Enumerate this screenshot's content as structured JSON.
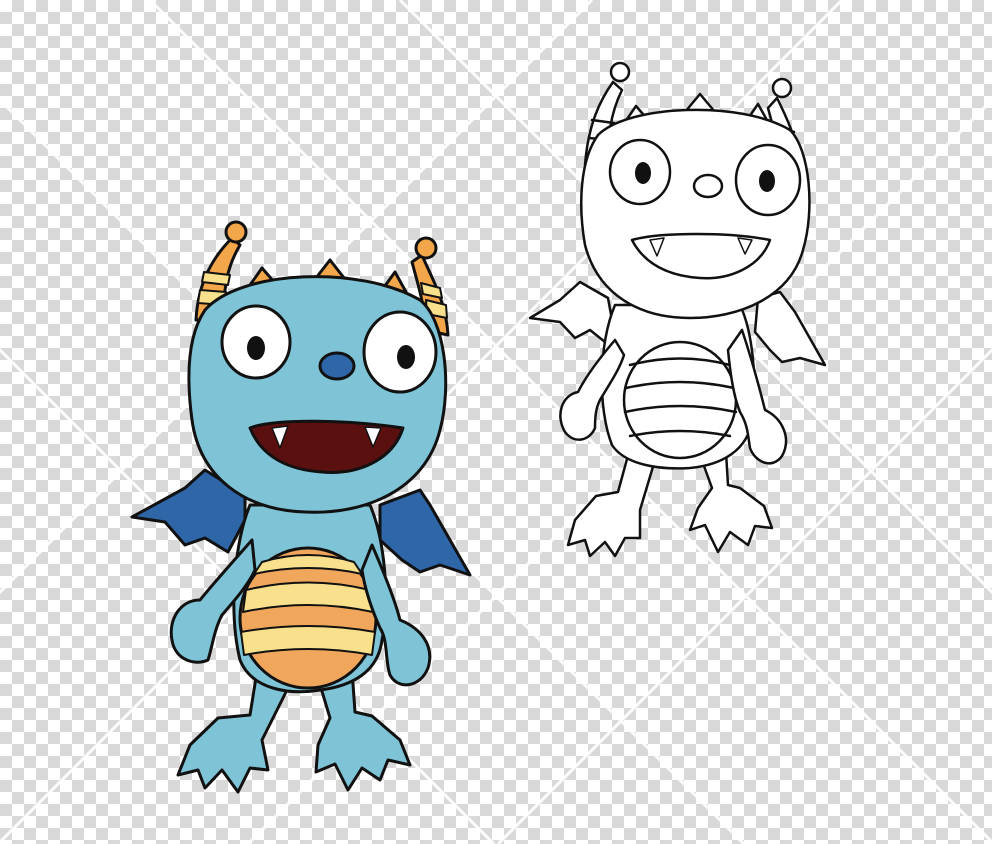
{
  "canvas": {
    "background": "transparency-checkerboard",
    "checker_color": "#d9d9d9",
    "watermark": "diagonal-lines"
  },
  "figures": [
    {
      "name": "monster-colored",
      "style": "filled",
      "colors": {
        "skin": "#7ec4d6",
        "belly_light": "#f9e08c",
        "belly_dark": "#f0a75c",
        "wings": "#2f66a8",
        "horns": "#f3a64a",
        "horn_stripes": "#f9e08c",
        "nose": "#2f66a8",
        "mouth": "#5b1010",
        "outline": "#111111"
      }
    },
    {
      "name": "monster-outline",
      "style": "line-art",
      "colors": {
        "outline": "#111111",
        "fill": "#ffffff"
      }
    }
  ]
}
